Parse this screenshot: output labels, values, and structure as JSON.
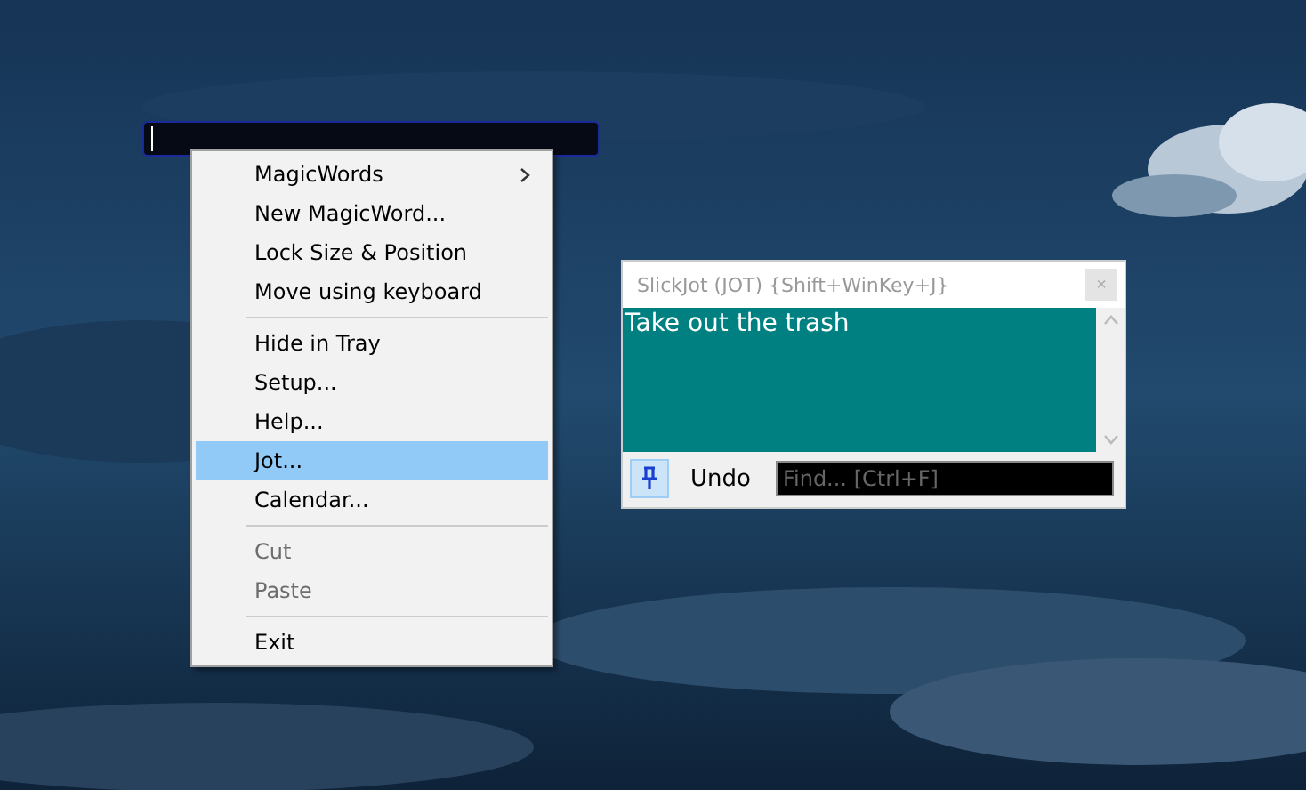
{
  "menu": {
    "items": [
      {
        "kind": "item",
        "label": "MagicWords",
        "submenu": true,
        "selected": false,
        "disabled": false
      },
      {
        "kind": "item",
        "label": "New MagicWord...",
        "submenu": false,
        "selected": false,
        "disabled": false
      },
      {
        "kind": "item",
        "label": "Lock Size & Position",
        "submenu": false,
        "selected": false,
        "disabled": false
      },
      {
        "kind": "item",
        "label": "Move using keyboard",
        "submenu": false,
        "selected": false,
        "disabled": false
      },
      {
        "kind": "separator"
      },
      {
        "kind": "item",
        "label": "Hide in Tray",
        "submenu": false,
        "selected": false,
        "disabled": false
      },
      {
        "kind": "item",
        "label": "Setup...",
        "submenu": false,
        "selected": false,
        "disabled": false
      },
      {
        "kind": "item",
        "label": "Help...",
        "submenu": false,
        "selected": false,
        "disabled": false
      },
      {
        "kind": "item",
        "label": "Jot...",
        "submenu": false,
        "selected": true,
        "disabled": false
      },
      {
        "kind": "item",
        "label": "Calendar...",
        "submenu": false,
        "selected": false,
        "disabled": false
      },
      {
        "kind": "separator"
      },
      {
        "kind": "item",
        "label": "Cut",
        "submenu": false,
        "selected": false,
        "disabled": true
      },
      {
        "kind": "item",
        "label": "Paste",
        "submenu": false,
        "selected": false,
        "disabled": true
      },
      {
        "kind": "separator"
      },
      {
        "kind": "item",
        "label": "Exit",
        "submenu": false,
        "selected": false,
        "disabled": false
      }
    ]
  },
  "jot_window": {
    "title": "SlickJot (JOT) {Shift+WinKey+J}",
    "close": "×",
    "note": "Take out the trash",
    "pinned": true,
    "undo": "Undo",
    "find": {
      "placeholder": "Find... [Ctrl+F]"
    }
  }
}
